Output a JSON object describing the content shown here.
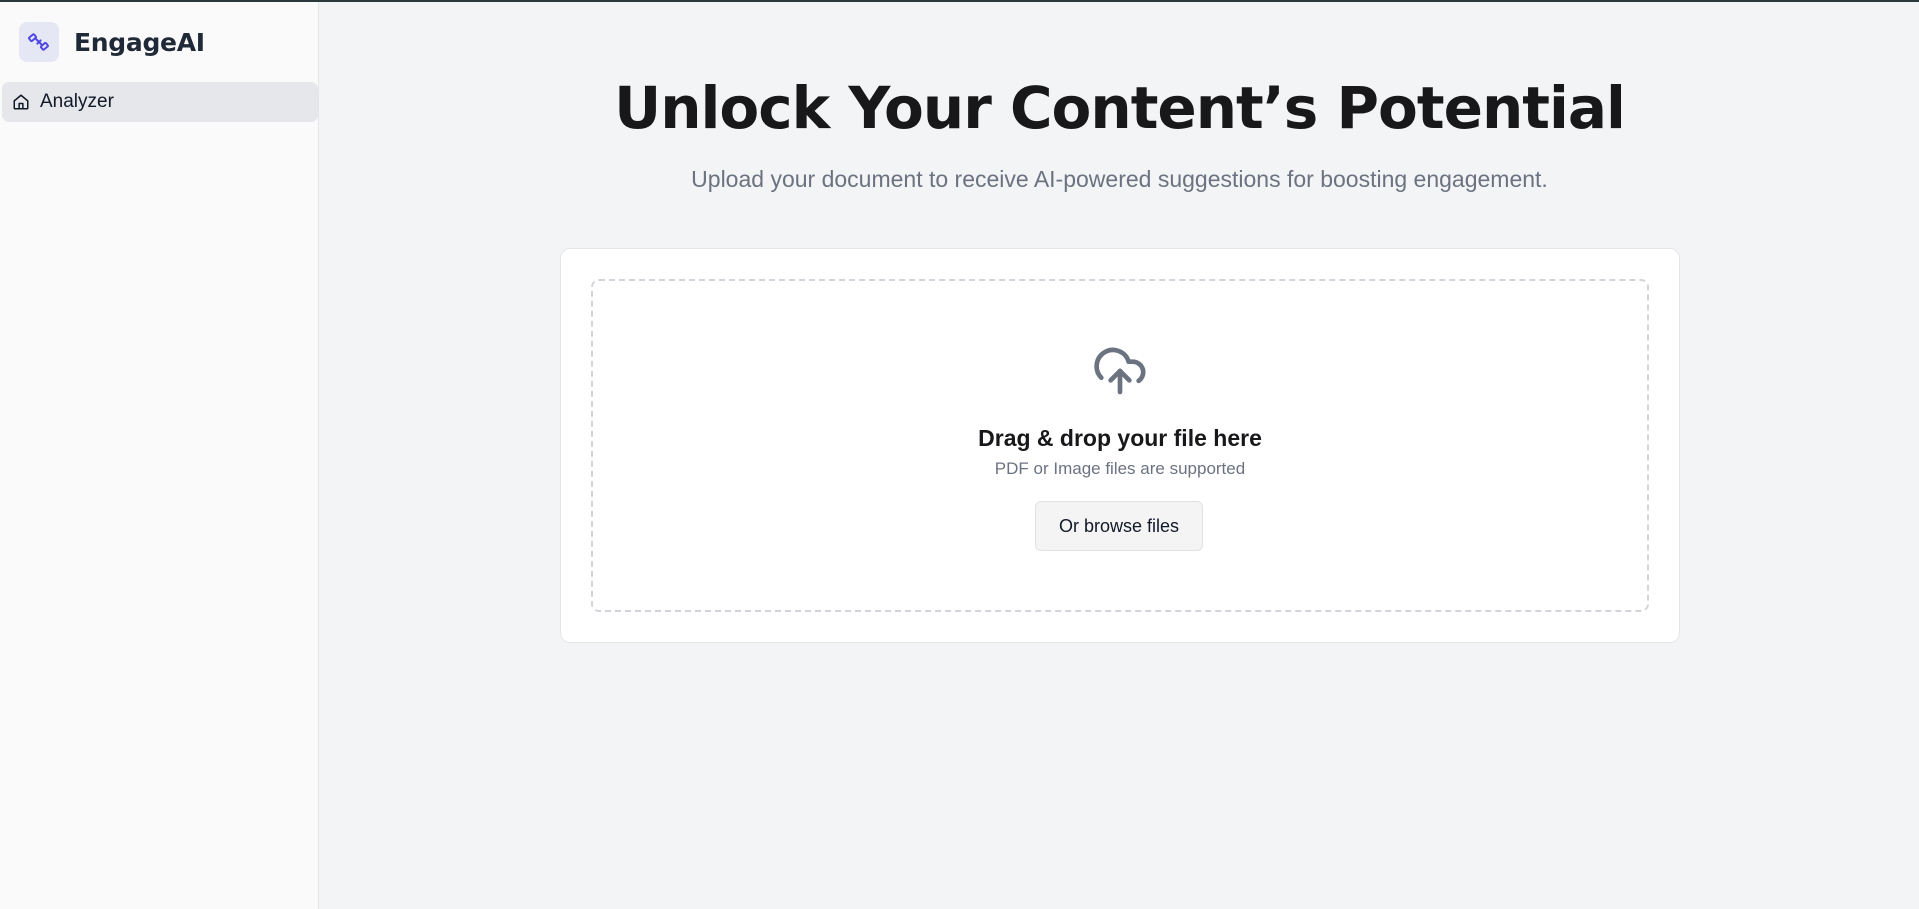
{
  "app": {
    "name": "EngageAI",
    "logo_icon": "satellite-icon",
    "accent_color": "#4f46e5"
  },
  "sidebar": {
    "items": [
      {
        "label": "Analyzer",
        "icon": "home-icon",
        "active": true
      }
    ]
  },
  "main": {
    "title": "Unlock Your Content’s Potential",
    "subtitle": "Upload your document to receive AI-powered suggestions for boosting engagement."
  },
  "upload": {
    "icon": "cloud-upload-icon",
    "title": "Drag & drop your file here",
    "hint": "PDF or Image files are supported",
    "browse_label": "Or browse files"
  }
}
